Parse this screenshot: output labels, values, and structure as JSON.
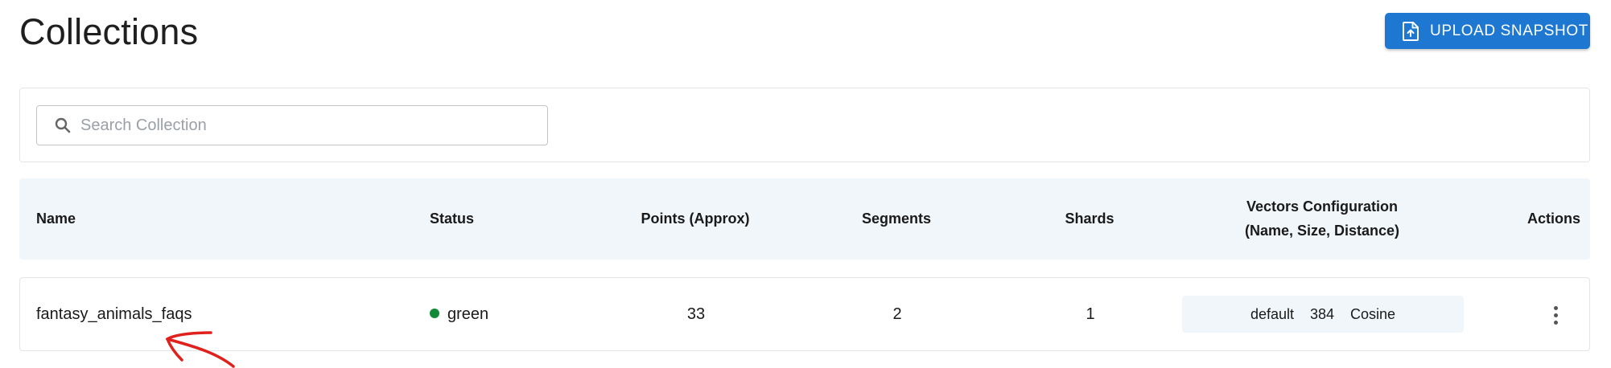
{
  "page": {
    "title": "Collections",
    "upload_button_label": "UPLOAD SNAPSHOT"
  },
  "search": {
    "placeholder": "Search Collection",
    "value": ""
  },
  "table": {
    "columns": {
      "name": "Name",
      "status": "Status",
      "points": "Points (Approx)",
      "segments": "Segments",
      "shards": "Shards",
      "vectors_line1": "Vectors Configuration",
      "vectors_line2": "(Name, Size, Distance)",
      "actions": "Actions"
    },
    "rows": [
      {
        "name": "fantasy_animals_faqs",
        "status": "green",
        "points": "33",
        "segments": "2",
        "shards": "1",
        "vector_name": "default",
        "vector_size": "384",
        "vector_distance": "Cosine"
      }
    ]
  },
  "icons": {
    "upload": "upload-file-icon",
    "search": "search-icon",
    "actions": "more-vertical-icon"
  },
  "colors": {
    "accent": "#1e78d2",
    "status_green": "#138a36",
    "header_bg": "#f1f6fa",
    "annotation": "#e0201c"
  }
}
